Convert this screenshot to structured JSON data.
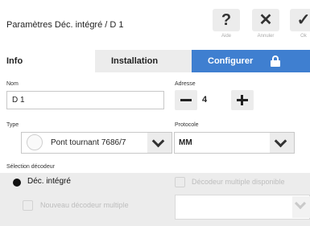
{
  "window": {
    "title": "Paramètres Déc. intégré / D 1"
  },
  "toolbar": {
    "help": {
      "glyph": "?",
      "label": "Aide"
    },
    "cancel": {
      "glyph": "✕",
      "label": "Annuler"
    },
    "ok": {
      "glyph": "✓",
      "label": "Ok"
    }
  },
  "tabs": [
    {
      "label": "Info",
      "active": true
    },
    {
      "label": "Installation",
      "active": false
    },
    {
      "label": "Configurer",
      "active": false,
      "icon": "lock-icon"
    }
  ],
  "form": {
    "nom": {
      "label": "Nom",
      "value": "D 1"
    },
    "adresse": {
      "label": "Adresse",
      "value": "4",
      "minus": "−",
      "plus": "+"
    },
    "type": {
      "label": "Type",
      "value": "Pont tournant 7686/7"
    },
    "protocole": {
      "label": "Protocole",
      "value": "MM"
    },
    "selection": {
      "label": "Sélection décodeur",
      "integrated": "Déc. intégré",
      "multi_available": "Décodeur multiple disponible",
      "new_multi": "Nouveau décodeur multiple"
    }
  },
  "colors": {
    "accent": "#3f7fd0",
    "band": "#ececec"
  }
}
